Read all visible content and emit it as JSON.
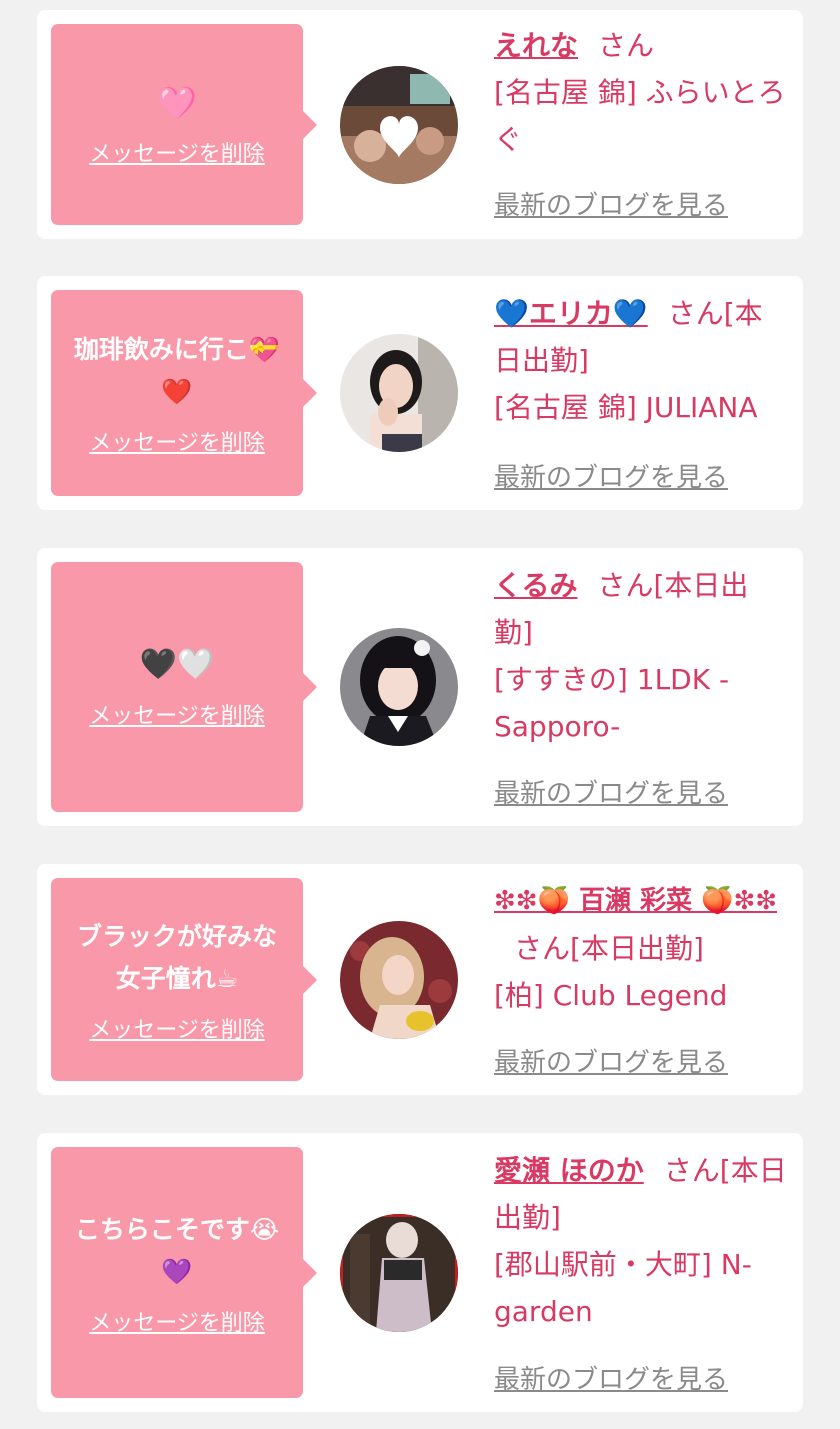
{
  "messages": [
    {
      "message": "🩷",
      "delete_label": "メッセージを削除",
      "name": "えれな",
      "san": "さん",
      "status": "",
      "shop": "[名古屋 錦] ふらいとろぐ",
      "blog_label": "最新のブログを見る",
      "avatar_icon": "photo-heart-sticker"
    },
    {
      "message": "珈琲飲みに行こ💝❤️",
      "delete_label": "メッセージを削除",
      "name": "💙エリカ💙",
      "san": "さん",
      "status": "[本日出勤]",
      "shop": "[名古屋 錦] JULIANA",
      "blog_label": "最新のブログを見る",
      "avatar_icon": "photo-portrait"
    },
    {
      "message": "🖤🤍",
      "delete_label": "メッセージを削除",
      "name": "くるみ",
      "san": "さん",
      "status": "[本日出勤]",
      "shop": "[すすきの] 1LDK -Sapporo-",
      "blog_label": "最新のブログを見る",
      "avatar_icon": "photo-portrait"
    },
    {
      "message": "ブラックが好みな女子憧れ☕",
      "delete_label": "メッセージを削除",
      "name": "❇❇🍑 百瀬 彩菜 🍑❇❇",
      "san": "さん",
      "status": "[本日出勤]",
      "shop": "[柏] Club Legend",
      "blog_label": "最新のブログを見る",
      "avatar_icon": "photo-portrait"
    },
    {
      "message": "こちらこそです😭💜",
      "delete_label": "メッセージを削除",
      "name": "愛瀬 ほのか",
      "san": "さん",
      "status": "[本日出勤]",
      "shop": "[郡山駅前・大町] N-garden",
      "blog_label": "最新のブログを見る",
      "avatar_icon": "photo-portrait"
    }
  ],
  "colors": {
    "page_bg": "#f1f1f1",
    "card_bg": "#ffffff",
    "bubble_bg": "#f998a9",
    "accent": "#d83a63",
    "link_gray": "#8a8a8a"
  }
}
